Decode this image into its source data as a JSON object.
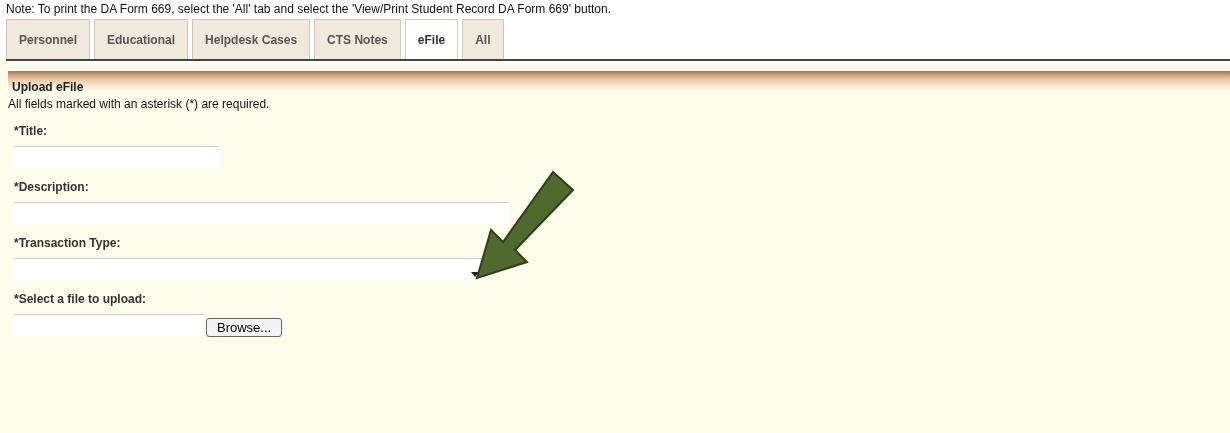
{
  "note": "Note: To print the DA Form 669, select the 'All' tab and select the 'View/Print Student Record DA Form 669' button.",
  "tabs": [
    {
      "label": "Personnel",
      "selected": false
    },
    {
      "label": "Educational",
      "selected": false
    },
    {
      "label": "Helpdesk Cases",
      "selected": false
    },
    {
      "label": "CTS Notes",
      "selected": false
    },
    {
      "label": "eFile",
      "selected": true
    },
    {
      "label": "All",
      "selected": false
    }
  ],
  "section_title": "Upload eFile",
  "instructions": "All fields marked with an asterisk (*) are required.",
  "fields": [
    {
      "label": "*Title:",
      "kind": "text"
    },
    {
      "label": "*Description:",
      "kind": "textwide"
    },
    {
      "label": "*Transaction Type:",
      "kind": "select"
    },
    {
      "label": "*Select a file to upload:",
      "kind": "file",
      "button": "Browse..."
    }
  ]
}
